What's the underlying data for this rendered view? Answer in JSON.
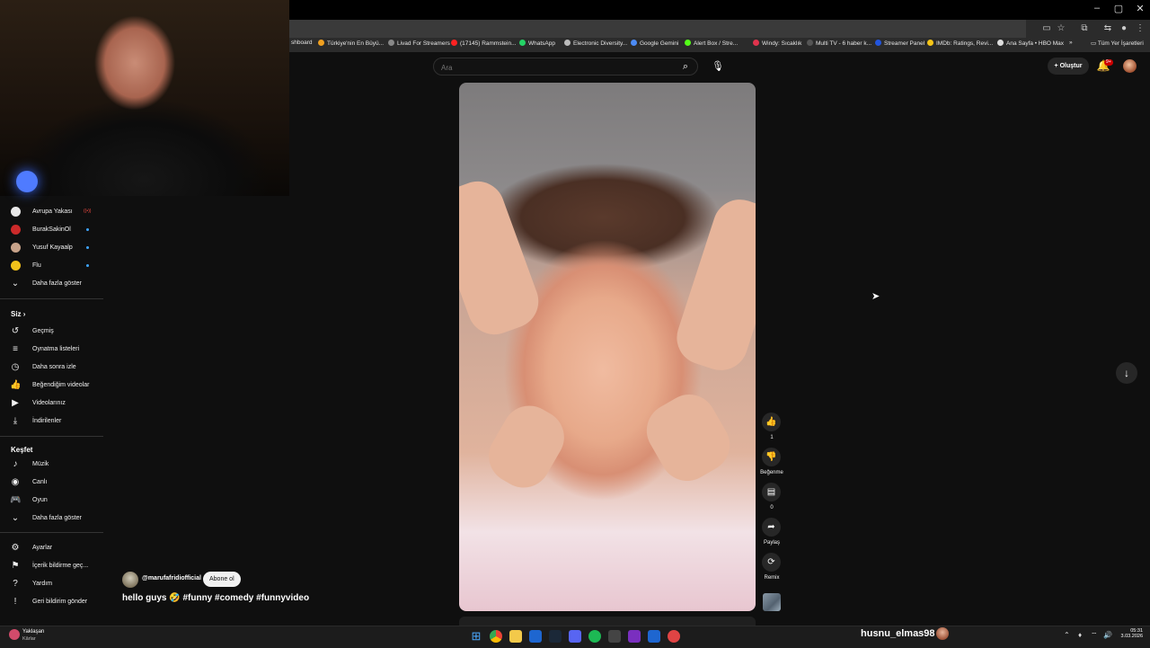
{
  "window": {
    "minimize": "–",
    "maximize": "▢",
    "close": "✕"
  },
  "bookmarks": [
    {
      "label": "shboard",
      "color": "#3a7bd5"
    },
    {
      "label": "Türkiye'nin En Büyü...",
      "color": "#f0a020"
    },
    {
      "label": "Livad For Streamers",
      "color": "#888888"
    },
    {
      "label": "(17145) Rammstein...",
      "color": "#ff2222"
    },
    {
      "label": "WhatsApp",
      "color": "#25d366"
    },
    {
      "label": "Electronic Diversity...",
      "color": "#bbbbbb"
    },
    {
      "label": "Google Gemini",
      "color": "#4c8bf5"
    },
    {
      "label": "Alert Box / Stre...",
      "color": "#53fc18"
    },
    {
      "label": "Windy: Sıcaklık",
      "color": "#e0334d"
    },
    {
      "label": "Multi TV - 6 haber k...",
      "color": "#333333"
    },
    {
      "label": "Streamer Panel",
      "color": "#2255dd"
    },
    {
      "label": "IMDb: Ratings, Revi...",
      "color": "#f5c518"
    },
    {
      "label": "Ana Sayfa • HBO Max",
      "color": "#dddddd"
    }
  ],
  "bookmarks_more": "»",
  "bookmarks_all": "Tüm Yer İşaretleri",
  "search": {
    "placeholder": "Ara"
  },
  "topbar": {
    "create_label": "Oluştur",
    "notification_count": "9+"
  },
  "sidebar": {
    "subscriptions": [
      {
        "label": "Avrupa Yakası",
        "avatar_color": "#e8e8e8",
        "indicator": "live",
        "indicator_text": "((•))"
      },
      {
        "label": "BurakSakinOl",
        "avatar_color": "#cc2a2a",
        "indicator": "dot"
      },
      {
        "label": "Yusuf Kayaalp",
        "avatar_color": "#c8a38a",
        "indicator": "dot"
      },
      {
        "label": "Flu",
        "avatar_color": "#f2c21b",
        "indicator": "dot"
      }
    ],
    "show_more": "Daha fazla göster",
    "you_title": "Siz",
    "you_items": [
      {
        "label": "Geçmiş",
        "icon": "↺"
      },
      {
        "label": "Oynatma listeleri",
        "icon": "≡"
      },
      {
        "label": "Daha sonra izle",
        "icon": "◷"
      },
      {
        "label": "Beğendiğim videolar",
        "icon": "👍"
      },
      {
        "label": "Videolarınız",
        "icon": "▶"
      },
      {
        "label": "İndirilenler",
        "icon": "⤓"
      }
    ],
    "explore_title": "Keşfet",
    "explore_items": [
      {
        "label": "Müzik",
        "icon": "♪"
      },
      {
        "label": "Canlı",
        "icon": "◉"
      },
      {
        "label": "Oyun",
        "icon": "🎮"
      }
    ],
    "explore_more": "Daha fazla göster",
    "footer_items": [
      {
        "label": "Ayarlar",
        "icon": "⚙"
      },
      {
        "label": "İçerik bildirme geç...",
        "icon": "⚑"
      },
      {
        "label": "Yardım",
        "icon": "?"
      },
      {
        "label": "Geri bildirim gönder",
        "icon": "!"
      }
    ]
  },
  "short": {
    "channel": "@marufafridiofficial",
    "subscribe_label": "Abone ol",
    "caption": "hello guys 🤣 #funny #comedy #funnyvideo",
    "actions": {
      "like_count": "1",
      "dislike_label": "Beğenme",
      "comment_count": "0",
      "share_label": "Paylaş",
      "remix_label": "Remix"
    }
  },
  "taskbar": {
    "weather_title": "Yaklaşan",
    "weather_sub": "Kârlar",
    "overlay_username": "husnu_elmas98",
    "time": "05:31",
    "date": "3.03.2026"
  }
}
